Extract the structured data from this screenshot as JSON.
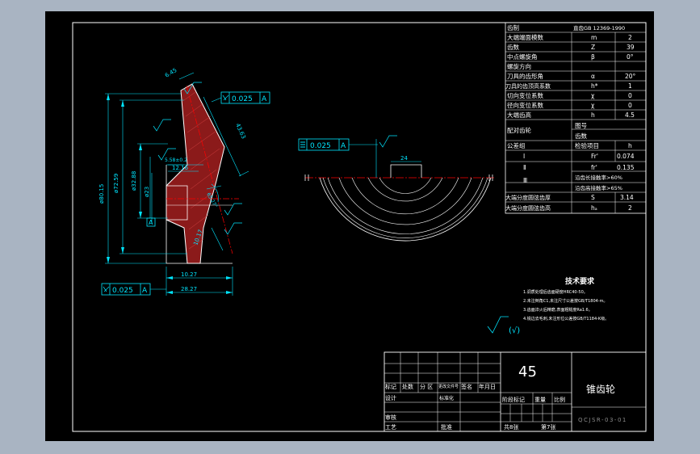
{
  "params": [
    {
      "name": "齿制",
      "sym": "直齿GB 12369-1990",
      "val": ""
    },
    {
      "name": "大端端面模数",
      "sym": "m",
      "val": "2"
    },
    {
      "name": "齿数",
      "sym": "Z",
      "val": "39"
    },
    {
      "name": "中点螺旋角",
      "sym": "β",
      "val": "0°"
    },
    {
      "name": "螺旋方向",
      "sym": "",
      "val": ""
    },
    {
      "name": "刀具的齿形角",
      "sym": "α",
      "val": "20°"
    },
    {
      "name": "刀具的齿顶高系数",
      "sym": "h*",
      "val": "1"
    },
    {
      "name": "切向变位系数",
      "sym": "χ",
      "val": "0"
    },
    {
      "name": "径向变位系数",
      "sym": "χ",
      "val": "0"
    },
    {
      "name": "大端齿高",
      "sym": "h",
      "val": "4.5"
    }
  ],
  "mate": {
    "label": "配对齿轮",
    "a": "图号",
    "b": "齿数"
  },
  "tolerance": {
    "label": "公差组",
    "a": "检验项目",
    "b": "h"
  },
  "groups": [
    {
      "name": "Ⅰ",
      "sym": "Fr'",
      "val": "0.074"
    },
    {
      "name": "Ⅱ",
      "sym": "fr'",
      "val": "0.135"
    },
    {
      "name": "Ⅲ",
      "a": "沿齿长接触率>60%",
      "b": "沿齿高接触率>65%"
    }
  ],
  "tail": [
    {
      "name": "大端分度圆弦齿厚",
      "sym": "S",
      "val": "3.14"
    },
    {
      "name": "大端分度圆弦齿高",
      "sym": "hₐ",
      "val": "2"
    }
  ],
  "dims": {
    "d80": "ø80.15",
    "d72": "ø72.59",
    "d32": "ø32.88",
    "d23": "ø23",
    "w645": "6.45",
    "w4363": "43.63",
    "w1216": "12.16",
    "w5582": "5.58±0.2",
    "a6527": "65.27°",
    "w1017": "10.17",
    "w1027": "10.27",
    "w2827": "28.27",
    "t0025": "0.025",
    "datumA": "A",
    "w24": "24",
    "rough": "3.2",
    "rough2": "6.3"
  },
  "notes": {
    "title": "技术要求",
    "lines": [
      "1.调质处理后齿面硬度HRC40-50。",
      "2.未注倒角C1,未注尺寸公差按GB/T1804-m。",
      "3.齿面淬火后精磨,表面粗糙度Ra1.6。",
      "4.锐边去毛刺,未注形位公差按GB/T1184-K级。"
    ],
    "symbol": "(√)"
  },
  "title_block": {
    "material": "45",
    "part_name": "锥齿轮",
    "drawing_no": "QCJSR-03-01",
    "labels": {
      "mark": "标记",
      "count": "处数",
      "zone": "分 区",
      "doc": "更改文件号",
      "sign": "签名",
      "date": "年月日",
      "design": "设计",
      "std": "标准化",
      "check": "审核",
      "process": "工艺",
      "approve": "批准",
      "stage": "阶段标记",
      "weight": "重量",
      "ratio": "比例",
      "total": "共8张",
      "sheet": "第7张"
    }
  },
  "colors": {
    "bg": "#a9b4c2",
    "paper": "#000000",
    "line": "#ffffff",
    "dim": "#00e5ff",
    "center": "#ff0000",
    "section": "#8b1a1a",
    "hatch": "#ffff00"
  }
}
